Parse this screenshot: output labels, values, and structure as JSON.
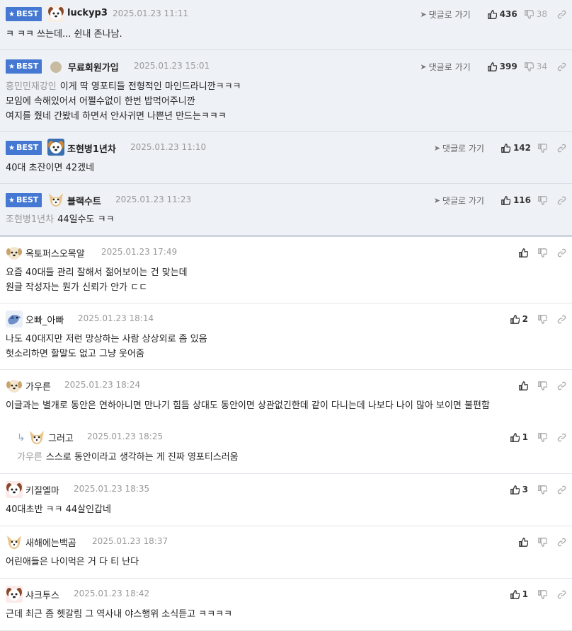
{
  "labels": {
    "best": "BEST",
    "reply_to": "댓글로 가기"
  },
  "colors": {
    "best_badge": "#4478d2",
    "best_bg": "#eef1f6"
  },
  "comments": [
    {
      "nick": "luckyp3",
      "time": "2025.01.23 11:11",
      "best": true,
      "avatar": "dog-icon",
      "up": "436",
      "down": "38",
      "mention": "",
      "lines": [
        "ㅋ ㅋㅋ 쓰는데... 쉰내 존나남."
      ]
    },
    {
      "nick": "무료회원가입",
      "time": "2025.01.23 15:01",
      "best": true,
      "avatar": "circle-icon",
      "up": "399",
      "down": "34",
      "mention": "흥민민재강인",
      "lines": [
        "이게 딱 영포티들 전형적인 마인드라니깐ㅋㅋㅋ",
        "모임에 속해있어서 어쩔수없이 한번 밥먹어주니깐",
        "여지를 줬네 간봤네 하면서 안사귀면 나쁜년 만드는ㅋㅋㅋ"
      ]
    },
    {
      "nick": "조현병1년차",
      "time": "2025.01.23 11:10",
      "best": true,
      "avatar": "dog-icon",
      "up": "142",
      "down": "",
      "mention": "",
      "lines": [
        "40대 초잔이면 42겠네"
      ]
    },
    {
      "nick": "블랙수트",
      "time": "2025.01.23 11:23",
      "best": true,
      "avatar": "fox-icon",
      "up": "116",
      "down": "",
      "mention": "조현병1년차",
      "lines": [
        "44일수도 ㅋㅋ"
      ]
    },
    {
      "nick": "옥토퍼스오목알",
      "time": "2025.01.23 17:49",
      "best": false,
      "avatar": "puppy-icon",
      "up": "",
      "down": "",
      "mention": "",
      "lines": [
        "요즘 40대들 관리 잘해서 젊어보이는 건 맞는데",
        "원글 작성자는 뭔가 신뢰가 안가 ㄷㄷ"
      ]
    },
    {
      "nick": "오빠_아빠",
      "time": "2025.01.23 18:14",
      "best": false,
      "avatar": "bird-icon",
      "up": "2",
      "down": "",
      "mention": "",
      "lines": [
        "나도 40대지만 저런 망상하는 사람 상상외로 좀 있음",
        "헛소리하면 할말도 없고 그냥 웃어줌"
      ]
    },
    {
      "nick": "가우른",
      "time": "2025.01.23 18:24",
      "best": false,
      "avatar": "puppy-icon",
      "up": "",
      "down": "",
      "mention": "",
      "lines": [
        "이글과는 별개로 동안은 연하아니면 만나기 힘듬 상대도 동안이면 상관없긴한데 같이 다니는데 나보다 나이 많아 보이면 불편함"
      ]
    },
    {
      "nick": "그러고",
      "time": "2025.01.23 18:25",
      "best": false,
      "reply": true,
      "avatar": "fox-icon",
      "up": "1",
      "down": "",
      "mention": "가우른",
      "lines": [
        "스스로 동안이라고 생각하는 게 진짜 영포티스러움"
      ]
    },
    {
      "nick": "키질엘마",
      "time": "2025.01.23 18:35",
      "best": false,
      "avatar": "dog-icon",
      "up": "3",
      "down": "",
      "mention": "",
      "lines": [
        "40대초반 ㅋㅋ 44살인갑네"
      ]
    },
    {
      "nick": "새해에는백곰",
      "time": "2025.01.23 18:37",
      "best": false,
      "avatar": "fox-icon",
      "up": "",
      "down": "",
      "mention": "",
      "lines": [
        "어린애들은 나이먹은 거 다 티 난다"
      ]
    },
    {
      "nick": "샤크투스",
      "time": "2025.01.23 18:42",
      "best": false,
      "avatar": "dog-icon",
      "up": "1",
      "down": "",
      "mention": "",
      "lines": [
        "근데 최근 좀 헷갈림 그 역사내 야스행위 소식듣고 ㅋㅋㅋㅋ"
      ]
    }
  ]
}
